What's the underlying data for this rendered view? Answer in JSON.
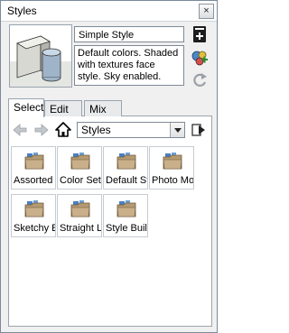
{
  "window": {
    "title": "Styles",
    "close_glyph": "×"
  },
  "style_info": {
    "name": "Simple Style",
    "description": "Default colors.  Shaded with textures face style.  Sky enabled."
  },
  "side_icons": [
    "details-toggle-icon",
    "create-style-icon",
    "update-style-icon"
  ],
  "tabs": [
    {
      "label": "Select",
      "active": true
    },
    {
      "label": "Edit",
      "active": false
    },
    {
      "label": "Mix",
      "active": false
    }
  ],
  "toolbar": {
    "collection_value": "Styles",
    "icons": [
      "back-arrow-icon",
      "forward-arrow-icon",
      "home-icon",
      "details-arrow-icon"
    ]
  },
  "collections": [
    {
      "label": "Assorted Styles"
    },
    {
      "label": "Color Sets"
    },
    {
      "label": "Default Styles"
    },
    {
      "label": "Photo Modeling"
    },
    {
      "label": "Sketchy Edges"
    },
    {
      "label": "Straight Lines"
    },
    {
      "label": "Style Builder Competition Winners"
    }
  ],
  "colors": {
    "folder_tan": "#b49a72",
    "folder_blue": "#4a7fc0",
    "tab_border": "#9aa4ae"
  }
}
